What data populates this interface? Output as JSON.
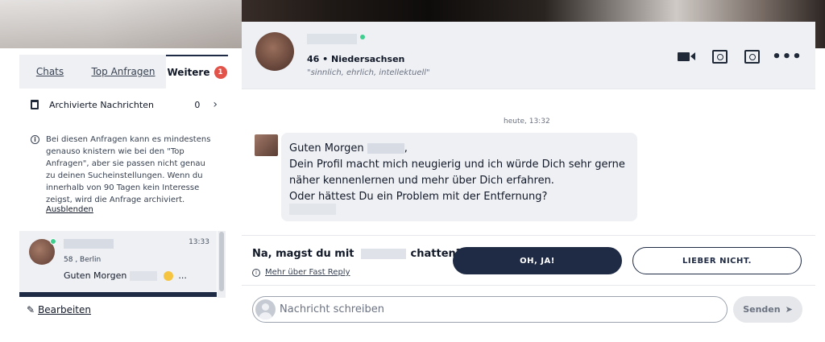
{
  "tabs": [
    {
      "label": "Chats"
    },
    {
      "label": "Top Anfragen"
    },
    {
      "label": "Weitere",
      "badge": "1"
    }
  ],
  "archived": {
    "label": "Archivierte Nachrichten",
    "count": "0"
  },
  "info": {
    "text": "Bei diesen Anfragen kann es mindestens genauso knistern wie bei den \"Top Anfragen\", aber sie passen nicht genau zu deinen Sucheinstellungen. Wenn du innerhalb von 90 Tagen kein Interesse zeigst, wird die Anfrage archiviert.",
    "hide_label": "Ausblenden"
  },
  "conversation": {
    "time": "13:33",
    "meta": "58 , Berlin",
    "preview_start": "Guten Morgen",
    "preview_end": "..."
  },
  "edit_label": "Bearbeiten",
  "chat_header": {
    "age_location": "46 • Niedersachsen",
    "tagline": "\"sinnlich, ehrlich, intellektuell\""
  },
  "messages": {
    "date": "heute, 13:32",
    "greeting": "Guten Morgen",
    "body": "Dein Profil macht mich neugierig und ich würde Dich sehr gerne\nnäher kennenlernen und mehr über Dich erfahren.\nOder hättest Du ein Problem mit der Entfernung?"
  },
  "fast_reply": {
    "question_start": "Na, magst du mit",
    "question_end": "chatten?",
    "link": "Mehr über Fast Reply",
    "yes": "OH, JA!",
    "no": "LIEBER NICHT."
  },
  "composer": {
    "placeholder": "Nachricht schreiben",
    "send": "Senden"
  },
  "colors": {
    "navy": "#1f2a44",
    "badge": "#e2534a",
    "online": "#3ecf8e",
    "panel": "#eef0f4"
  }
}
